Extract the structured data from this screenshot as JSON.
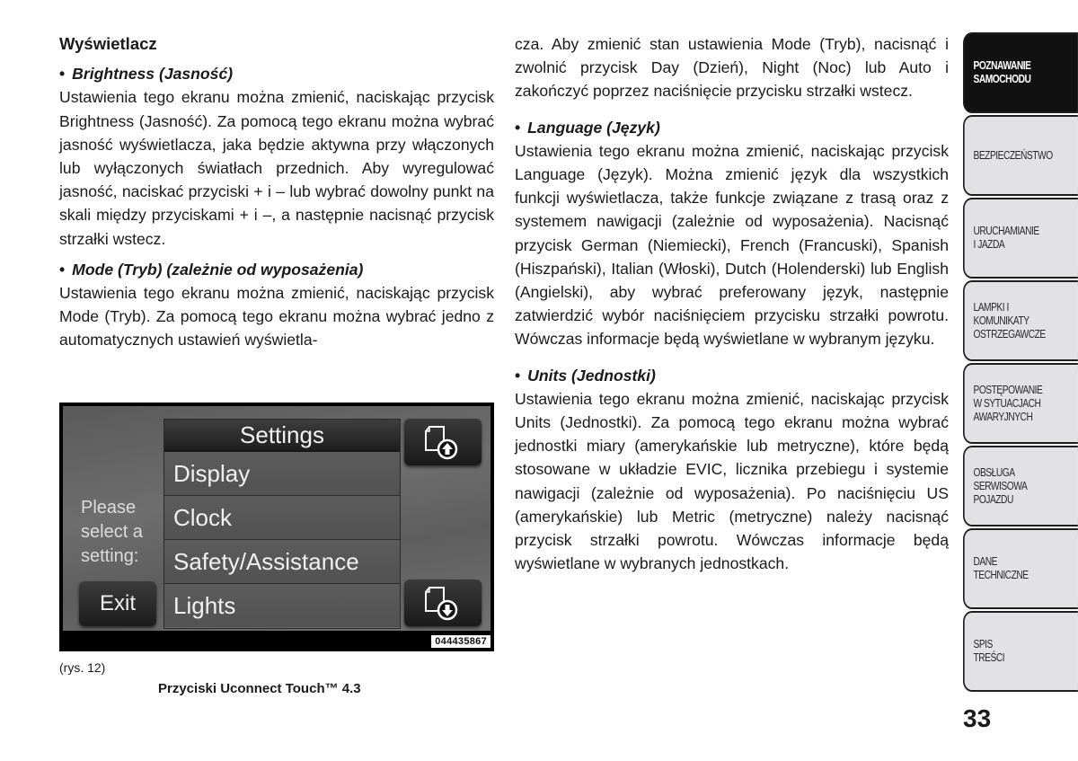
{
  "left_column": {
    "section_title": "Wyświetlacz",
    "items": [
      {
        "heading": "Brightness (Jasność)",
        "body": "Ustawienia tego ekranu można zmienić, naciskając przycisk Brightness (Jasność). Za pomocą tego ekranu można wybrać jasność wyświetlacza, jaka będzie aktywna przy włączonych lub wyłączonych światłach przednich. Aby wyregulować jasność, naciskać przyciski + i – lub wybrać dowolny punkt na skali między przyciskami + i –, a następnie nacisnąć przycisk strzałki wstecz."
      },
      {
        "heading": "Mode (Tryb) (zależnie od wyposażenia)",
        "body": "Ustawienia tego ekranu można zmienić, naciskając przycisk Mode (Tryb). Za pomocą tego ekranu można wybrać jedno z automatycznych ustawień wyświetla-"
      }
    ]
  },
  "figure": {
    "prompt": "Please\nselect a\nsetting:",
    "exit_label": "Exit",
    "menu_title": "Settings",
    "menu_items": [
      "Display",
      "Clock",
      "Safety/Assistance",
      "Lights"
    ],
    "page_up_icon": "page-up-icon",
    "page_down_icon": "page-down-icon",
    "figure_id": "044435867",
    "caption_number": "(rys. 12)",
    "caption": "Przyciski Uconnect Touch™ 4.3"
  },
  "right_column": {
    "continuation": "cza. Aby zmienić stan ustawienia Mode (Tryb), nacisnąć i zwolnić przycisk Day (Dzień), Night (Noc) lub Auto i zakończyć poprzez naciśnięcie przycisku strzałki wstecz.",
    "items": [
      {
        "heading": "Language (Język)",
        "body": "Ustawienia tego ekranu można zmienić, naciskając przycisk Language (Język). Można zmienić język dla wszystkich funkcji wyświetlacza, także funkcje związane z trasą oraz z systemem nawigacji (zależnie od wyposażenia). Nacisnąć przycisk German (Niemiecki), French (Francuski), Spanish (Hiszpański), Italian (Włoski), Dutch (Holenderski) lub English (Angielski), aby wybrać preferowany język, następnie zatwierdzić wybór naciśnięciem przycisku strzałki powrotu. Wówczas informacje będą wyświetlane w wybranym języku."
      },
      {
        "heading": "Units (Jednostki)",
        "body": "Ustawienia tego ekranu można zmienić, naciskając przycisk Units (Jednostki). Za pomocą tego ekranu można wybrać jednostki miary (amerykańskie lub metryczne), które będą stosowane w układzie EVIC, licznika przebiegu i systemie nawigacji (zależnie od wyposażenia). Po naciśnięciu US (amerykańskie) lub Metric (metryczne) należy nacisnąć przycisk strzałki powrotu. Wówczas informacje będą wyświetlane w wybranych jednostkach."
      }
    ]
  },
  "side_tabs": [
    {
      "label": "POZNAWANIE\nSAMOCHODU",
      "active": true
    },
    {
      "label": "BEZPIECZEŃSTWO",
      "active": false
    },
    {
      "label": "URUCHAMIANIE\nI JAZDA",
      "active": false
    },
    {
      "label": "LAMPKI I\nKOMUNIKATY\nOSTRZEGAWCZE",
      "active": false
    },
    {
      "label": "POSTĘPOWANIE\nW SYTUACJACH\nAWARYJNYCH",
      "active": false
    },
    {
      "label": "OBSŁUGA\nSERWISOWA\nPOJAZDU",
      "active": false
    },
    {
      "label": "DANE\nTECHNICZNE",
      "active": false
    },
    {
      "label": "SPIS\nTREŚCI",
      "active": false
    }
  ],
  "page_number": "33",
  "colors": {
    "active_tab": "#111111",
    "inactive_tab": "#e2e2e4",
    "text": "#1a1a1a"
  }
}
